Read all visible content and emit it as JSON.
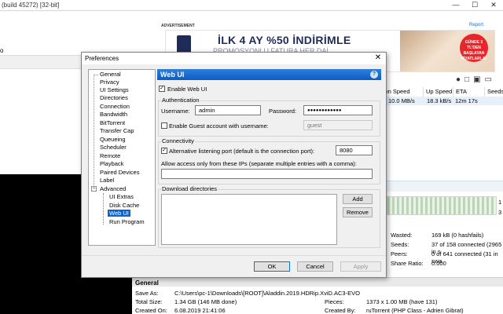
{
  "main_window": {
    "title": "(build 45272) [32-bit]",
    "left_item": "o",
    "ad_label": "ADVERTISEMENT",
    "ad_report": "Report",
    "ad_headline": "İLK 4 AY %50 İNDİRİMLE",
    "ad_subline": "PROMOSYONLU FATURA HER DAİ",
    "ad_badge": "GÜNDE 3 TL'DEN BAŞLAYAN FİYATLARLA!",
    "columns": {
      "down_speed": "own Speed",
      "up_speed": "Up Speed",
      "eta": "ETA",
      "seeds": "Seeds/"
    },
    "row_values": {
      "down_speed": "10.0 MB/s",
      "up_speed": "18.3 kB/s",
      "eta": "12m 17s"
    },
    "side_numbers": [
      "1",
      "3"
    ],
    "stats": [
      {
        "label": "Wasted:",
        "value": "169 kB (0 hashfails)"
      },
      {
        "label": "Seeds:",
        "value": "37 of 158 connected (2965 in s"
      },
      {
        "label": "Peers:",
        "value": "0 of 641 connected (31 in swa"
      },
      {
        "label": "Share Ratio:",
        "value": "0.000"
      }
    ],
    "general": {
      "title": "General",
      "save_as_label": "Save As:",
      "save_as_value": "C:\\Users\\pc-1\\Downloads\\[ROOT]\\Aladdin.2019.HDRip.XviD.AC3-EVO",
      "total_size_label": "Total Size:",
      "total_size_value": "1.34 GB (146 MB done)",
      "pieces_label": "Pieces:",
      "pieces_value": "1373 x 1.00 MB (have 131)",
      "created_on_label": "Created On:",
      "created_on_value": "6.08.2019 21:41:06",
      "created_by_label": "Created By:",
      "created_by_value": "ruTorrent (PHP Class - Adrien Gibrat)"
    }
  },
  "dialog": {
    "title": "Preferences",
    "tree": [
      "General",
      "Privacy",
      "UI Settings",
      "Directories",
      "Connection",
      "Bandwidth",
      "BitTorrent",
      "Transfer Cap",
      "Queueing",
      "Scheduler",
      "Remote",
      "Playback",
      "Paired Devices",
      "Label",
      "Advanced",
      "UI Extras",
      "Disk Cache",
      "Web UI",
      "Run Program"
    ],
    "panel_title": "Web UI",
    "help": "?",
    "enable_webui": "Enable Web UI",
    "auth_group": "Authentication",
    "username_label": "Username:",
    "username_value": "admin",
    "password_label": "Password:",
    "password_value": "●●●●●●●●●●●●",
    "guest_label": "Enable Guest account with username:",
    "guest_value": "guest",
    "conn_group": "Connectivity",
    "alt_port_label": "Alternative listening port (default is the connection port):",
    "alt_port_value": "8080",
    "allow_ips_label": "Allow access only from these IPs (separate multiple entries with a comma):",
    "allow_ips_value": "",
    "dl_group": "Download directories",
    "add_btn": "Add",
    "remove_btn": "Remove",
    "ok_btn": "OK",
    "cancel_btn": "Cancel",
    "apply_btn": "Apply"
  }
}
